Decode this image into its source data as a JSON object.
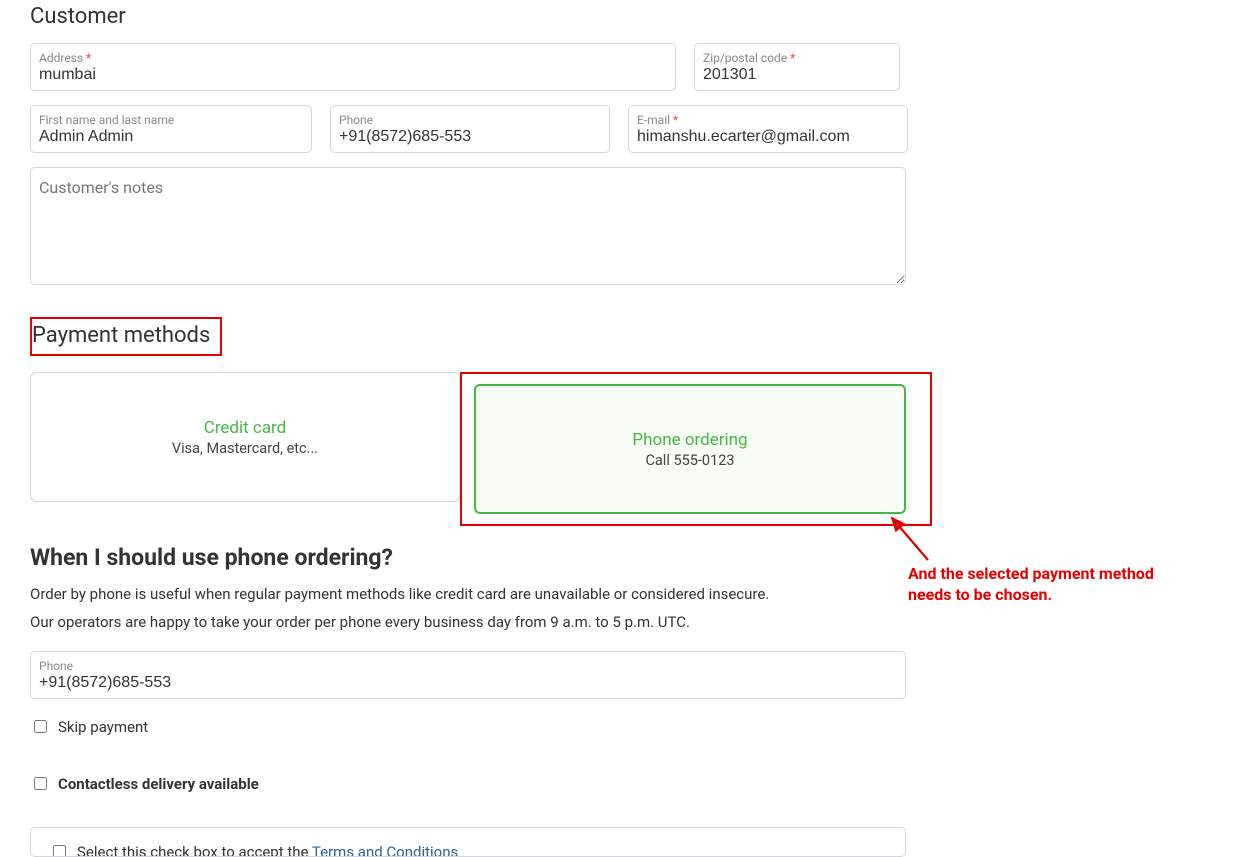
{
  "customer": {
    "section_title": "Customer",
    "address_label": "Address",
    "address_value": "mumbai",
    "zip_label": "Zip/postal code",
    "zip_value": "201301",
    "name_label": "First name and last name",
    "name_value": "Admin Admin",
    "phone_label": "Phone",
    "phone_value": "+91(8572)685-553",
    "email_label": "E-mail",
    "email_value": "himanshu.ecarter@gmail.com",
    "notes_placeholder": "Customer's notes"
  },
  "payment": {
    "section_title": "Payment methods",
    "methods": [
      {
        "name": "Credit card",
        "sub": "Visa, Mastercard, etc..."
      },
      {
        "name": "Phone ordering",
        "sub": "Call 555-0123"
      }
    ],
    "info_title": "When I should use phone ordering?",
    "info_p1": "Order by phone is useful when regular payment methods like credit card are unavailable or considered insecure.",
    "info_p2": "Our operators are happy to take your order per phone every business day from 9 a.m. to 5 p.m. UTC.",
    "phone2_label": "Phone",
    "phone2_value": "+91(8572)685-553",
    "skip_label": "Skip payment",
    "contactless_label": "Contactless delivery available",
    "terms_prefix": "Select this check box to accept the ",
    "terms_link": "Terms and Conditions"
  },
  "annotation": {
    "text": "And the selected payment method needs to be chosen."
  },
  "required_marker": " *"
}
